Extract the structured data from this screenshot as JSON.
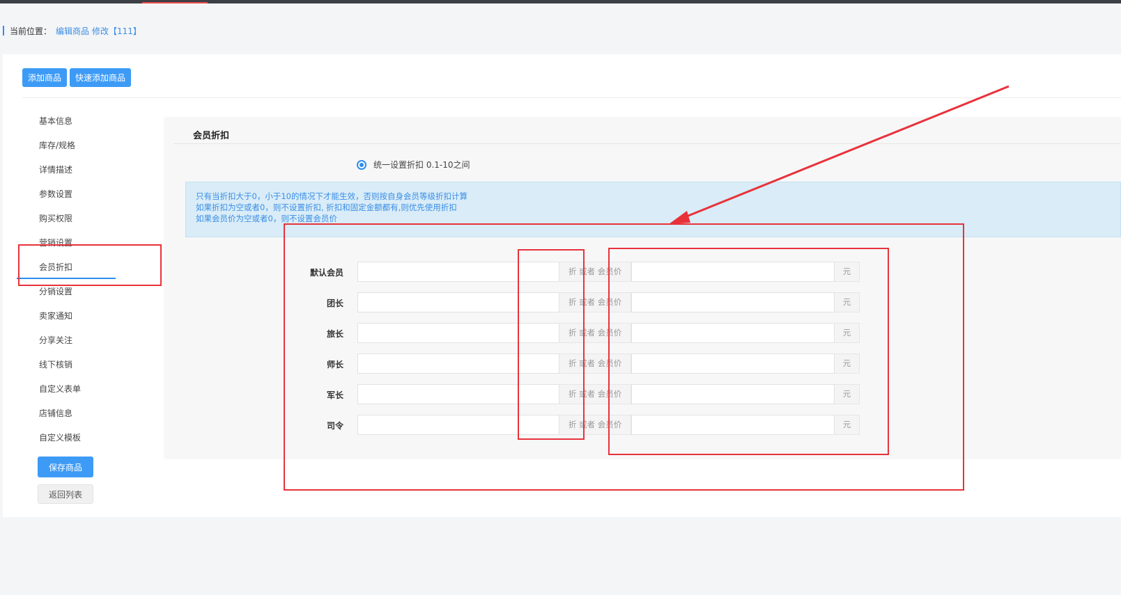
{
  "breadcrumb": {
    "label": "当前位置：",
    "link": "编辑商品",
    "action": "修改【111】"
  },
  "toolbar": {
    "add_label": "添加商品",
    "quick_add_label": "快速添加商品"
  },
  "sidebar": {
    "items": [
      "基本信息",
      "库存/规格",
      "详情描述",
      "参数设置",
      "购买权限",
      "营销设置",
      "会员折扣",
      "分销设置",
      "卖家通知",
      "分享关注",
      "线下核销",
      "自定义表单",
      "店铺信息",
      "自定义模板"
    ],
    "active": "会员折扣",
    "save_label": "保存商品",
    "back_label": "返回列表"
  },
  "section": {
    "title": "会员折扣",
    "radio_label": "统一设置折扣 0.1-10之间",
    "notice": [
      "只有当折扣大于0，小于10的情况下才能生效，否则按自身会员等级折扣计算",
      "如果折扣为空或者0，则不设置折扣, 折扣和固定金额都有,则优先使用折扣",
      "如果会员价为空或者0，则不设置会员价"
    ]
  },
  "form": {
    "addon_label": "折 或者 会员价",
    "unit_label": "元",
    "rows": [
      {
        "label": "默认会员",
        "discount": "",
        "price": ""
      },
      {
        "label": "团长",
        "discount": "",
        "price": ""
      },
      {
        "label": "旅长",
        "discount": "",
        "price": ""
      },
      {
        "label": "师长",
        "discount": "",
        "price": ""
      },
      {
        "label": "军长",
        "discount": "",
        "price": ""
      },
      {
        "label": "司令",
        "discount": "",
        "price": ""
      }
    ]
  },
  "colors": {
    "primary": "#3d9bf6",
    "annotation": "#e8323a",
    "notice_bg": "#d9ecf7"
  }
}
